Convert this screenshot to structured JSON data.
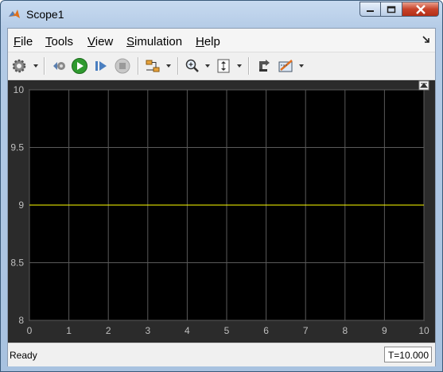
{
  "window": {
    "title": "Scope1"
  },
  "menu": [
    {
      "underline": "F",
      "rest": "ile"
    },
    {
      "underline": "T",
      "rest": "ools"
    },
    {
      "underline": "V",
      "rest": "iew"
    },
    {
      "underline": "S",
      "rest": "imulation"
    },
    {
      "underline": "H",
      "rest": "elp"
    }
  ],
  "toolbar": {
    "items": [
      "settings-icon",
      "step-back-icon",
      "run-icon",
      "step-forward-icon",
      "stop-icon",
      "signal-selector-icon",
      "zoom-in-icon",
      "autoscale-icon",
      "highlight-block-icon",
      "measurements-icon"
    ]
  },
  "colors": {
    "plot_bg": "#000000",
    "frame_bg": "#2b2b2b",
    "grid": "#5a5a5a",
    "trace": "#ffff00",
    "axis_text": "#bfbfbf"
  },
  "chart_data": {
    "type": "line",
    "title": "",
    "xlabel": "",
    "ylabel": "",
    "xlim": [
      0,
      10
    ],
    "ylim": [
      8,
      10
    ],
    "x_ticks": [
      "0",
      "1",
      "2",
      "3",
      "4",
      "5",
      "6",
      "7",
      "8",
      "9",
      "10"
    ],
    "y_ticks": [
      "8",
      "8.5",
      "9",
      "9.5",
      "10"
    ],
    "grid": true,
    "series": [
      {
        "x": [
          0,
          10
        ],
        "y": [
          9,
          9
        ],
        "color": "#ffff00"
      }
    ]
  },
  "status": {
    "text": "Ready",
    "time": "T=10.000"
  }
}
